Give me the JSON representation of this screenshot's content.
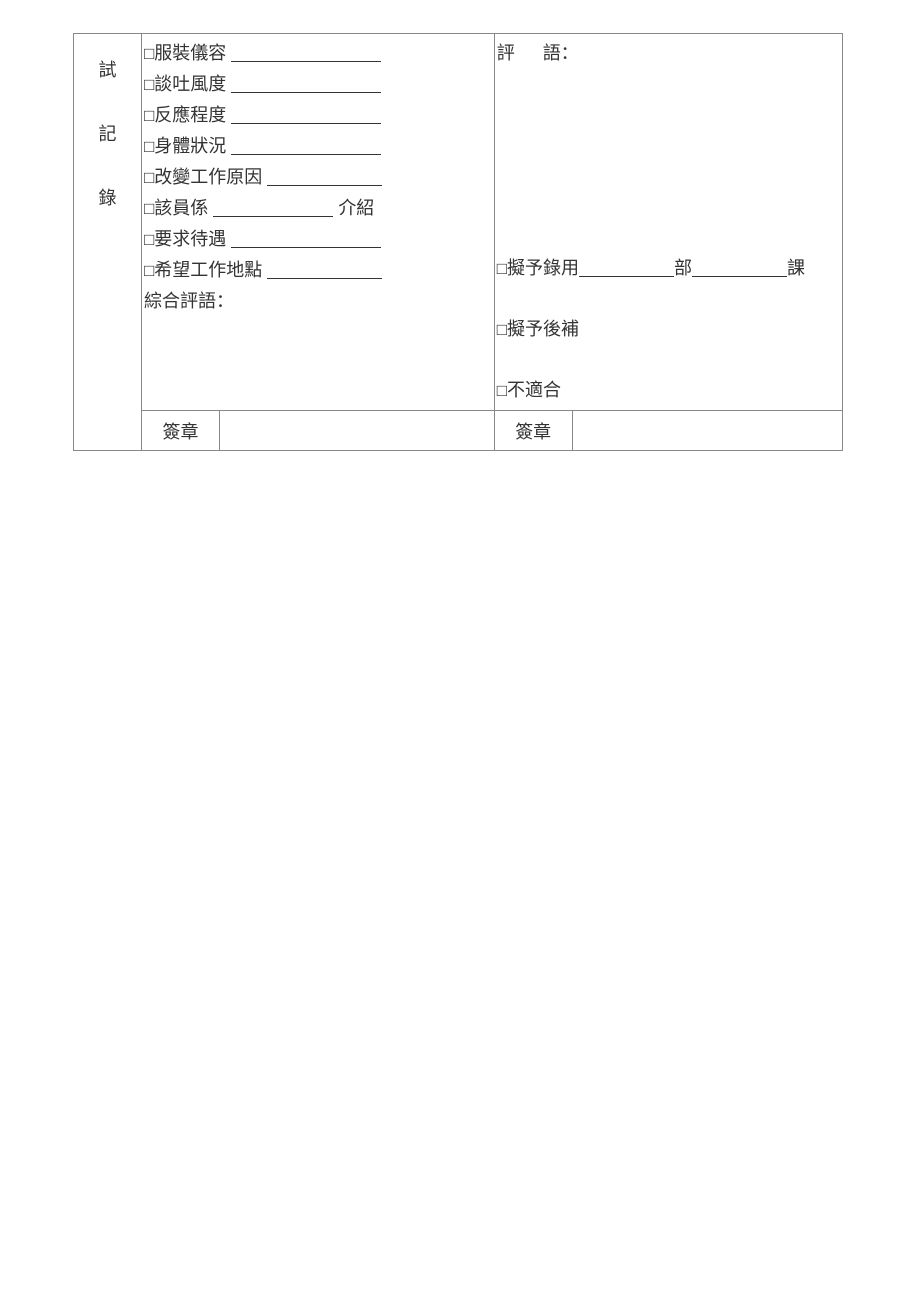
{
  "rowLabel": {
    "char1": "試",
    "char2": "記",
    "char3": "錄"
  },
  "left": {
    "item1": "服裝儀容",
    "item2": "談吐風度",
    "item3": "反應程度",
    "item4": "身體狀況",
    "item5": "改變工作原因",
    "item6_prefix": "該員係",
    "item6_suffix": "介紹",
    "item7": "要求待遇",
    "item8": "希望工作地點",
    "summary": "綜合評語："
  },
  "right": {
    "commentLabel": "評語：",
    "hire_prefix": "擬予錄用",
    "hire_dept": "部",
    "hire_section": "課",
    "waitlist": "擬予後補",
    "notSuitable": "不適合"
  },
  "signature": "簽章",
  "checkbox": "□"
}
